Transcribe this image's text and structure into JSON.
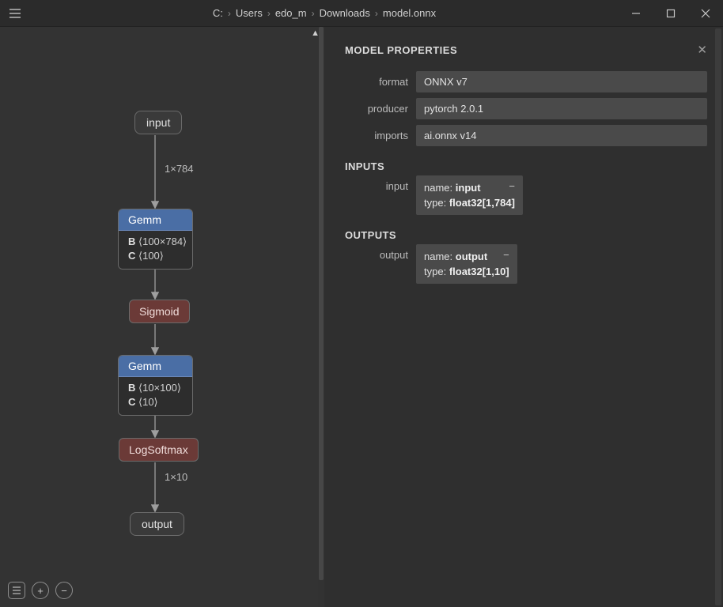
{
  "breadcrumb": [
    "C:",
    "Users",
    "edo_m",
    "Downloads",
    "model.onnx"
  ],
  "graph": {
    "input": "input",
    "edge1": "1×784",
    "gemm1": {
      "title": "Gemm",
      "B": "B",
      "Bval": "⟨100×784⟩",
      "C": "C",
      "Cval": "⟨100⟩"
    },
    "sigmoid": "Sigmoid",
    "gemm2": {
      "title": "Gemm",
      "B": "B",
      "Bval": "⟨10×100⟩",
      "C": "C",
      "Cval": "⟨10⟩"
    },
    "logsoftmax": "LogSoftmax",
    "edge2": "1×10",
    "output": "output"
  },
  "panel": {
    "title": "MODEL PROPERTIES",
    "props": {
      "format": {
        "label": "format",
        "value": "ONNX v7"
      },
      "producer": {
        "label": "producer",
        "value": "pytorch 2.0.1"
      },
      "imports": {
        "label": "imports",
        "value": "ai.onnx v14"
      }
    },
    "inputs_title": "INPUTS",
    "input": {
      "label": "input",
      "name_k": "name:",
      "name_v": "input",
      "type_k": "type:",
      "type_v": "float32[1,784]"
    },
    "outputs_title": "OUTPUTS",
    "output": {
      "label": "output",
      "name_k": "name:",
      "name_v": "output",
      "type_k": "type:",
      "type_v": "float32[1,10]"
    }
  }
}
